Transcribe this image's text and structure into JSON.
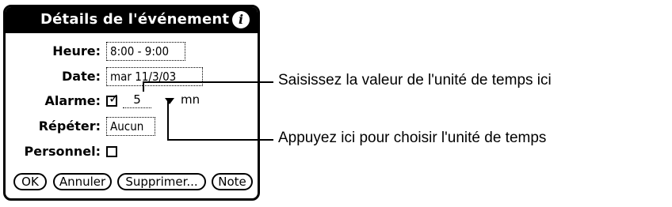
{
  "dialog": {
    "title": "Détails de l'événement",
    "info_icon": "info-icon"
  },
  "fields": {
    "time_label": "Heure:",
    "time_value": "8:00 - 9:00",
    "date_label": "Date:",
    "date_value": "mar 11/3/03",
    "alarm_label": "Alarme:",
    "alarm_checked": true,
    "alarm_value": "5",
    "alarm_unit": "mn",
    "repeat_label": "Répéter:",
    "repeat_value": "Aucun",
    "private_label": "Personnel:",
    "private_checked": false
  },
  "buttons": {
    "ok": "OK",
    "cancel": "Annuler",
    "delete": "Supprimer...",
    "note": "Note"
  },
  "callouts": {
    "value_hint": "Saisissez la valeur de l'unité de temps ici",
    "unit_hint": "Appuyez ici pour choisir l'unité de temps"
  }
}
